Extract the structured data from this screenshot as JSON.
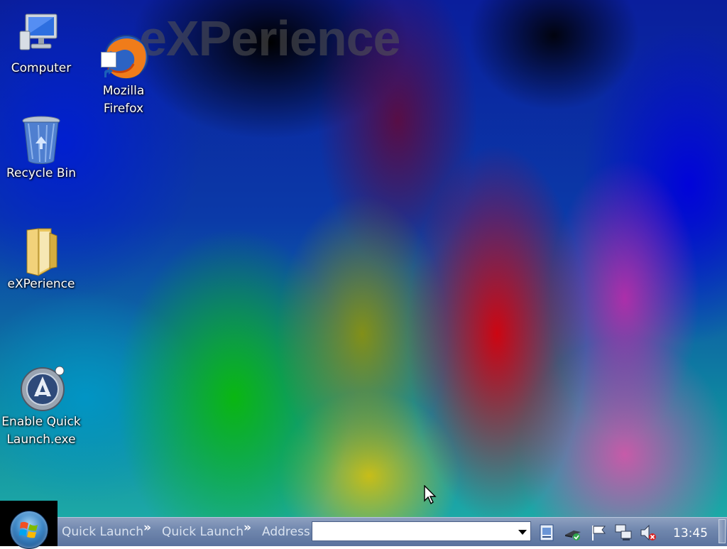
{
  "desktop": {
    "watermark_text": "eXPerience",
    "icons": [
      {
        "label": "Computer",
        "icon": "computer-icon"
      },
      {
        "label": "Mozilla\nFirefox",
        "icon": "firefox-icon"
      },
      {
        "label": "Recycle Bin",
        "icon": "recycle-bin-icon"
      },
      {
        "label": "eXPerience",
        "icon": "folder-icon"
      },
      {
        "label": "Enable Quick\nLaunch.exe",
        "icon": "app-launcher-icon"
      }
    ]
  },
  "taskbar": {
    "start_icon": "windows-logo-icon",
    "toolbars": [
      "Quick Launch",
      "Quick Launch",
      "Address"
    ],
    "chevron": "»",
    "address": {
      "value": "",
      "placeholder": ""
    },
    "tray_icons": [
      "document-icon",
      "network-check-icon",
      "flag-icon",
      "network-computers-icon",
      "speaker-muted-icon"
    ],
    "clock": "13:45"
  },
  "colors": {
    "taskbar": "#6f86ad",
    "toolbar_text": "#d9e2f0",
    "icon_label": "#ffffff"
  }
}
